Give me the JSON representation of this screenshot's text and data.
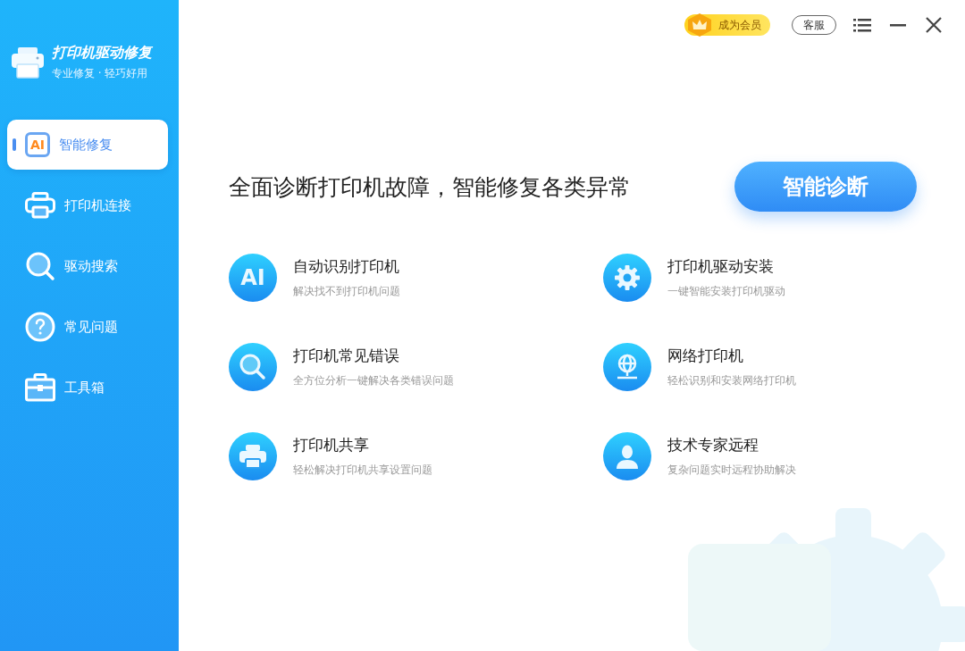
{
  "app": {
    "title": "打印机驱动修复",
    "subtitle": "专业修复 · 轻巧好用"
  },
  "nav": [
    {
      "label": "智能修复",
      "kind": "ai",
      "icon_text": "AI",
      "selected": true
    },
    {
      "label": "打印机连接",
      "kind": "printer",
      "selected": false
    },
    {
      "label": "驱动搜索",
      "kind": "search",
      "selected": false
    },
    {
      "label": "常见问题",
      "kind": "help",
      "selected": false
    },
    {
      "label": "工具箱",
      "kind": "toolbox",
      "selected": false
    }
  ],
  "topbar": {
    "vip": "成为会员",
    "service": "客服"
  },
  "headline": "全面诊断打印机故障，智能修复各类异常",
  "diagnose_button": "智能诊断",
  "features": [
    {
      "kind": "ai",
      "icon_text": "AI",
      "title": "自动识别打印机",
      "desc": "解决找不到打印机问题"
    },
    {
      "kind": "gear",
      "title": "打印机驱动安装",
      "desc": "一键智能安装打印机驱动"
    },
    {
      "kind": "search",
      "title": "打印机常见错误",
      "desc": "全方位分析一键解决各类错误问题"
    },
    {
      "kind": "globe",
      "title": "网络打印机",
      "desc": "轻松识别和安装网络打印机"
    },
    {
      "kind": "printer",
      "title": "打印机共享",
      "desc": "轻松解决打印机共享设置问题"
    },
    {
      "kind": "person",
      "title": "技术专家远程",
      "desc": "复杂问题实时远程协助解决"
    }
  ]
}
